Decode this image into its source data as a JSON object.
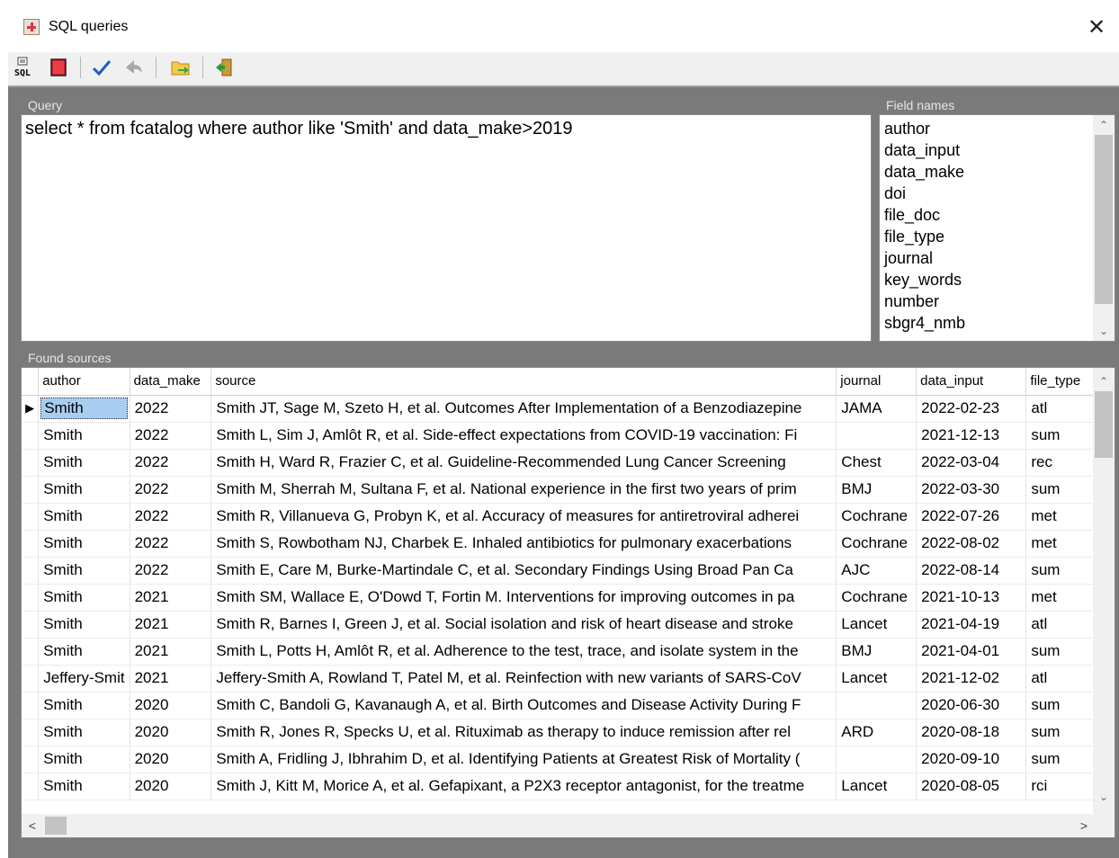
{
  "window": {
    "title": "SQL queries",
    "close_glyph": "✕"
  },
  "toolbar": {
    "buttons": [
      {
        "name": "sql-icon",
        "label": "SQL"
      },
      {
        "name": "red-book-icon"
      },
      {
        "name": "checkmark-icon"
      },
      {
        "name": "back-arrow-icon"
      },
      {
        "name": "open-folder-icon"
      },
      {
        "name": "exit-door-icon"
      }
    ]
  },
  "query": {
    "label": "Query",
    "text": "select * from fcatalog where author like 'Smith' and data_make>2019"
  },
  "fields": {
    "label": "Field names",
    "items": [
      "author",
      "data_input",
      "data_make",
      "doi",
      "file_doc",
      "file_type",
      "journal",
      "key_words",
      "number",
      "sbgr4_nmb"
    ]
  },
  "results": {
    "label": "Found sources",
    "columns": [
      "author",
      "data_make",
      "source",
      "journal",
      "data_input",
      "file_type"
    ],
    "current_row_indicator": "▶",
    "rows": [
      [
        "Smith",
        "2022",
        "Smith JT, Sage M, Szeto H, et al. Outcomes After Implementation of a Benzodiazepine",
        "JAMA",
        "2022-02-23",
        "atl"
      ],
      [
        "Smith",
        "2022",
        "Smith L, Sim J, Amlôt R, et al. Side-effect expectations from COVID-19 vaccination: Fi",
        "",
        "2021-12-13",
        "sum"
      ],
      [
        "Smith",
        "2022",
        "Smith H, Ward R, Frazier C, et al. Guideline-Recommended Lung Cancer Screening",
        "Chest",
        "2022-03-04",
        "rec"
      ],
      [
        "Smith",
        "2022",
        "Smith M, Sherrah M, Sultana F, et al. National experience in the first two years of prim",
        "BMJ",
        "2022-03-30",
        "sum"
      ],
      [
        "Smith",
        "2022",
        "Smith R, Villanueva G, Probyn K, et al. Accuracy of measures for antiretroviral adherei",
        "Cochrane",
        "2022-07-26",
        "met"
      ],
      [
        "Smith",
        "2022",
        "Smith S, Rowbotham NJ, Charbek E. Inhaled antibiotics for pulmonary exacerbations",
        "Cochrane",
        "2022-08-02",
        "met"
      ],
      [
        "Smith",
        "2022",
        "Smith E, Care M, Burke-Martindale C, et al. Secondary Findings Using Broad Pan Ca",
        "AJC",
        "2022-08-14",
        "sum"
      ],
      [
        "Smith",
        "2021",
        "Smith SM, Wallace E, O'Dowd T, Fortin M. Interventions for improving outcomes in pa",
        "Cochrane",
        "2021-10-13",
        "met"
      ],
      [
        "Smith",
        "2021",
        "Smith R, Barnes I, Green J, et al. Social isolation and risk of heart disease and stroke",
        "Lancet",
        "2021-04-19",
        "atl"
      ],
      [
        "Smith",
        "2021",
        "Smith L, Potts H, Amlôt R, et al. Adherence to the test, trace, and isolate system in the",
        "BMJ",
        "2021-04-01",
        "sum"
      ],
      [
        "Jeffery-Smit",
        "2021",
        "Jeffery-Smith A, Rowland T, Patel M, et al. Reinfection with new variants of SARS-CoV",
        "Lancet",
        "2021-12-02",
        "atl"
      ],
      [
        "Smith",
        "2020",
        "Smith C, Bandoli G, Kavanaugh A, et al. Birth Outcomes and Disease Activity During F",
        "",
        "2020-06-30",
        "sum"
      ],
      [
        "Smith",
        "2020",
        "Smith R, Jones R, Specks U, et al. Rituximab as therapy to induce remission after rel",
        "ARD",
        "2020-08-18",
        "sum"
      ],
      [
        "Smith",
        "2020",
        "Smith A, Fridling J, Ibhrahim D, et al. Identifying Patients at Greatest Risk of Mortality (",
        "",
        "2020-09-10",
        "sum"
      ],
      [
        "Smith",
        "2020",
        "Smith J, Kitt M, Morice A, et al. Gefapixant, a P2X3 receptor antagonist, for the treatme",
        "Lancet",
        "2020-08-05",
        "rci"
      ]
    ]
  },
  "scroll": {
    "up": "⌃",
    "down": "⌄",
    "left": "<",
    "right": ">"
  }
}
